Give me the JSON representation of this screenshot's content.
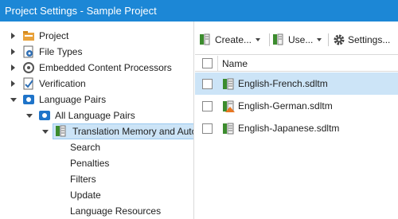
{
  "window": {
    "title": "Project Settings - Sample Project"
  },
  "tree": {
    "items": [
      {
        "label": "Project",
        "icon": "project-icon"
      },
      {
        "label": "File Types",
        "icon": "file-types-icon"
      },
      {
        "label": "Embedded Content Processors",
        "icon": "embedded-content-icon"
      },
      {
        "label": "Verification",
        "icon": "verification-icon"
      },
      {
        "label": "Language Pairs",
        "icon": "language-pairs-icon"
      },
      {
        "label": "All Language Pairs",
        "icon": "language-pair-icon"
      },
      {
        "label": "Translation Memory and Auto",
        "icon": "translation-memory-icon"
      },
      {
        "label": "Search"
      },
      {
        "label": "Penalties"
      },
      {
        "label": "Filters"
      },
      {
        "label": "Update"
      },
      {
        "label": "Language Resources"
      }
    ]
  },
  "toolbar": {
    "create_label": "Create...",
    "use_label": "Use...",
    "settings_label": "Settings..."
  },
  "grid": {
    "header": {
      "name": "Name"
    },
    "rows": [
      {
        "name": "English-French.sdltm",
        "selected": true
      },
      {
        "name": "English-German.sdltm",
        "selected": false
      },
      {
        "name": "English-Japanese.sdltm",
        "selected": false
      }
    ]
  },
  "colors": {
    "titlebar": "#1c87d6",
    "selection": "#cce4f7",
    "tm_green": "#3c8c2e"
  }
}
